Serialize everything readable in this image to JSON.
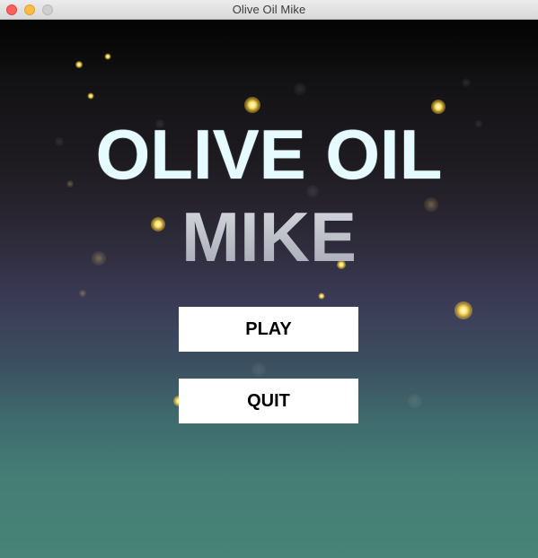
{
  "window": {
    "title": "Olive Oil Mike"
  },
  "game": {
    "title_line_1": "OLIVE OIL",
    "title_line_2": "MIKE",
    "menu": {
      "play_label": "PLAY",
      "quit_label": "QUIT"
    }
  },
  "colors": {
    "title_line_1": "#e6fbff",
    "title_line_2": "#c6c8d0",
    "button_background": "#ffffff",
    "button_text": "#000000",
    "spark": "#ffe36a"
  }
}
